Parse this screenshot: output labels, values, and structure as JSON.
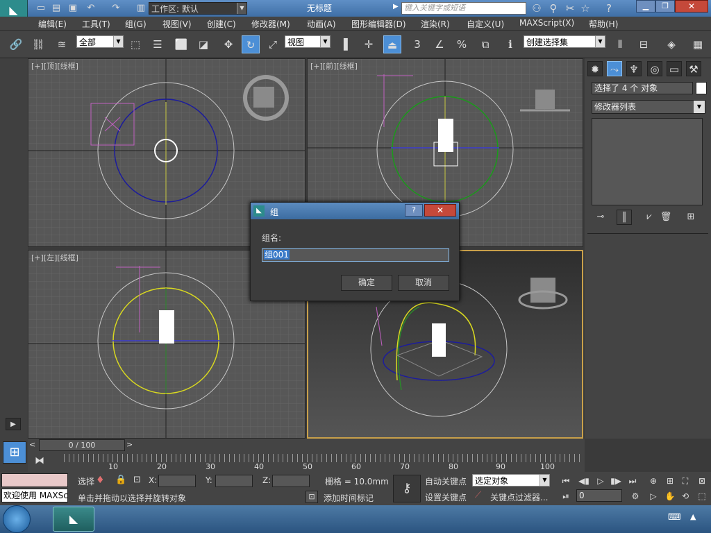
{
  "titlebar": {
    "workspace_label": "工作区: 默认",
    "title": "无标题",
    "search_placeholder": "键入关键字或短语"
  },
  "menus": [
    "编辑(E)",
    "工具(T)",
    "组(G)",
    "视图(V)",
    "创建(C)",
    "修改器(M)",
    "动画(A)",
    "图形编辑器(D)",
    "渲染(R)",
    "自定义(U)",
    "MAXScript(X)",
    "帮助(H)"
  ],
  "toolbar": {
    "filter_value": "全部",
    "ref_coord_value": "视图",
    "snap_angle": "3",
    "snap_percent": "%",
    "named_selection": "创建选择集"
  },
  "viewports": {
    "top_label": "[+][顶][线框]",
    "front_label": "[+][前][线框]",
    "left_label": "[+][左][线框]",
    "persp_label": ""
  },
  "cmdpanel": {
    "selection_text": "选择了 4 个 对象",
    "modifier_list": "修改器列表"
  },
  "dialog": {
    "title": "组",
    "name_label": "组名:",
    "name_value": "组001",
    "ok": "确定",
    "cancel": "取消"
  },
  "timeline": {
    "frame": "0 / 100",
    "ticks": [
      "10",
      "20",
      "30",
      "40",
      "50",
      "60",
      "70",
      "80",
      "90",
      "100"
    ]
  },
  "status": {
    "welcome": "欢迎使用 MAXSc",
    "select_short": "选择",
    "hint": "单击并拖动以选择并旋转对象",
    "x_label": "X:",
    "y_label": "Y:",
    "z_label": "Z:",
    "grid": "栅格 = 10.0mm",
    "add_time_tag": "添加时间标记",
    "auto_key": "自动关键点",
    "set_key": "设置关键点",
    "selected_object": "选定对象",
    "key_filter": "关键点过滤器...",
    "frame_value": "0"
  },
  "colors": {
    "accent": "#3f6fa6",
    "highlight": "#4c8fd6",
    "persp_border": "#c9a04a"
  }
}
